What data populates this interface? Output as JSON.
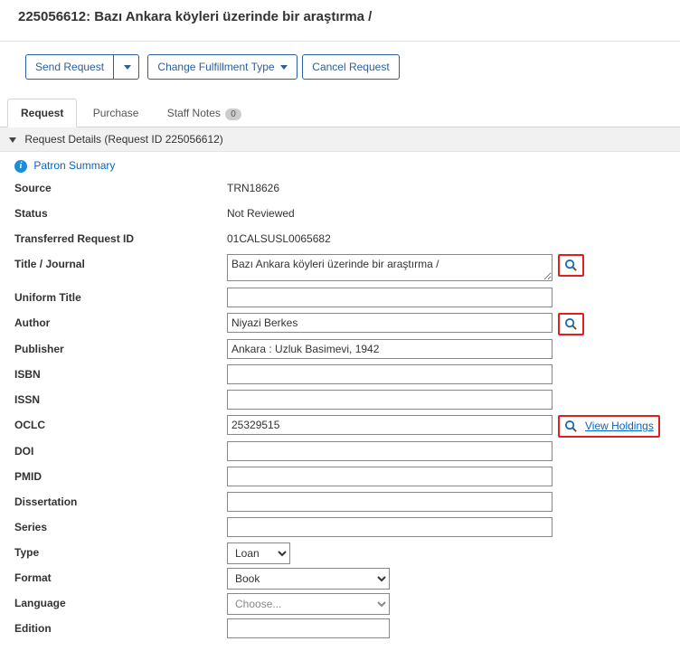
{
  "header": {
    "id": "225056612",
    "title": "Bazı Ankara köyleri üzerinde bir araştırma /"
  },
  "actions": {
    "send_request": "Send Request",
    "change_fulfillment": "Change Fulfillment Type",
    "cancel_request": "Cancel Request"
  },
  "tabs": {
    "request": "Request",
    "purchase": "Purchase",
    "staff_notes": "Staff Notes",
    "staff_notes_count": "0"
  },
  "section": {
    "header": "Request Details (Request ID 225056612)"
  },
  "patron_summary_label": "Patron Summary",
  "fields": {
    "source": {
      "label": "Source",
      "value": "TRN18626"
    },
    "status": {
      "label": "Status",
      "value": "Not Reviewed"
    },
    "transferred_request_id": {
      "label": "Transferred Request ID",
      "value": "01CALSUSL0065682"
    },
    "title_journal": {
      "label": "Title / Journal",
      "value": "Bazı Ankara köyleri üzerinde bir araştırma /"
    },
    "uniform_title": {
      "label": "Uniform Title",
      "value": ""
    },
    "author": {
      "label": "Author",
      "value": "Niyazi Berkes"
    },
    "publisher": {
      "label": "Publisher",
      "value": "Ankara : Uzluk Basimevi, 1942"
    },
    "isbn": {
      "label": "ISBN",
      "value": ""
    },
    "issn": {
      "label": "ISSN",
      "value": ""
    },
    "oclc": {
      "label": "OCLC",
      "value": "25329515"
    },
    "doi": {
      "label": "DOI",
      "value": ""
    },
    "pmid": {
      "label": "PMID",
      "value": ""
    },
    "dissertation": {
      "label": "Dissertation",
      "value": ""
    },
    "series": {
      "label": "Series",
      "value": ""
    },
    "type": {
      "label": "Type",
      "value": "Loan"
    },
    "format": {
      "label": "Format",
      "value": "Book"
    },
    "language": {
      "label": "Language",
      "placeholder": "Choose..."
    },
    "edition": {
      "label": "Edition",
      "value": ""
    }
  },
  "links": {
    "view_holdings": "View Holdings"
  }
}
